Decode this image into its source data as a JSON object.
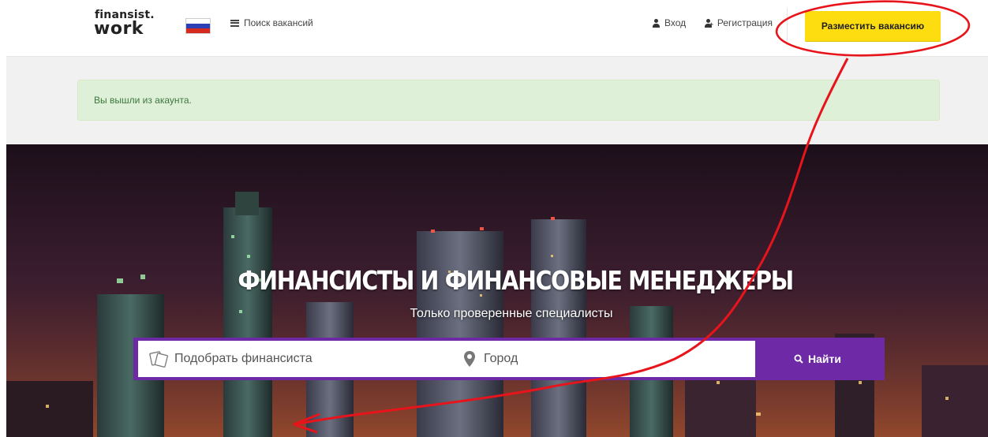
{
  "header": {
    "logo_line1": "finansist.",
    "logo_line2": "work",
    "nav_search_label": "Поиск вакансий",
    "login_label": "Вход",
    "register_label": "Регистрация",
    "post_vacancy_label": "Разместить вакансию"
  },
  "alert": {
    "message": "Вы вышли из акаунта."
  },
  "hero": {
    "title": "ФИНАНСИСТЫ И ФИНАНСОВЫЕ МЕНЕДЖЕРЫ",
    "subtitle": "Только проверенные специалисты"
  },
  "search": {
    "what_placeholder": "Подобрать финансиста",
    "city_placeholder": "Город",
    "submit_label": "Найти"
  },
  "colors": {
    "accent_yellow": "#fddd10",
    "accent_purple": "#6e2aa6",
    "alert_green_bg": "#dff0d8",
    "alert_green_text": "#3c763d",
    "annotation_red": "#e8141b"
  },
  "icons": [
    "list-icon",
    "user-icon",
    "user-plus-icon",
    "russia-flag",
    "cards-icon",
    "map-pin-icon",
    "search-icon"
  ]
}
